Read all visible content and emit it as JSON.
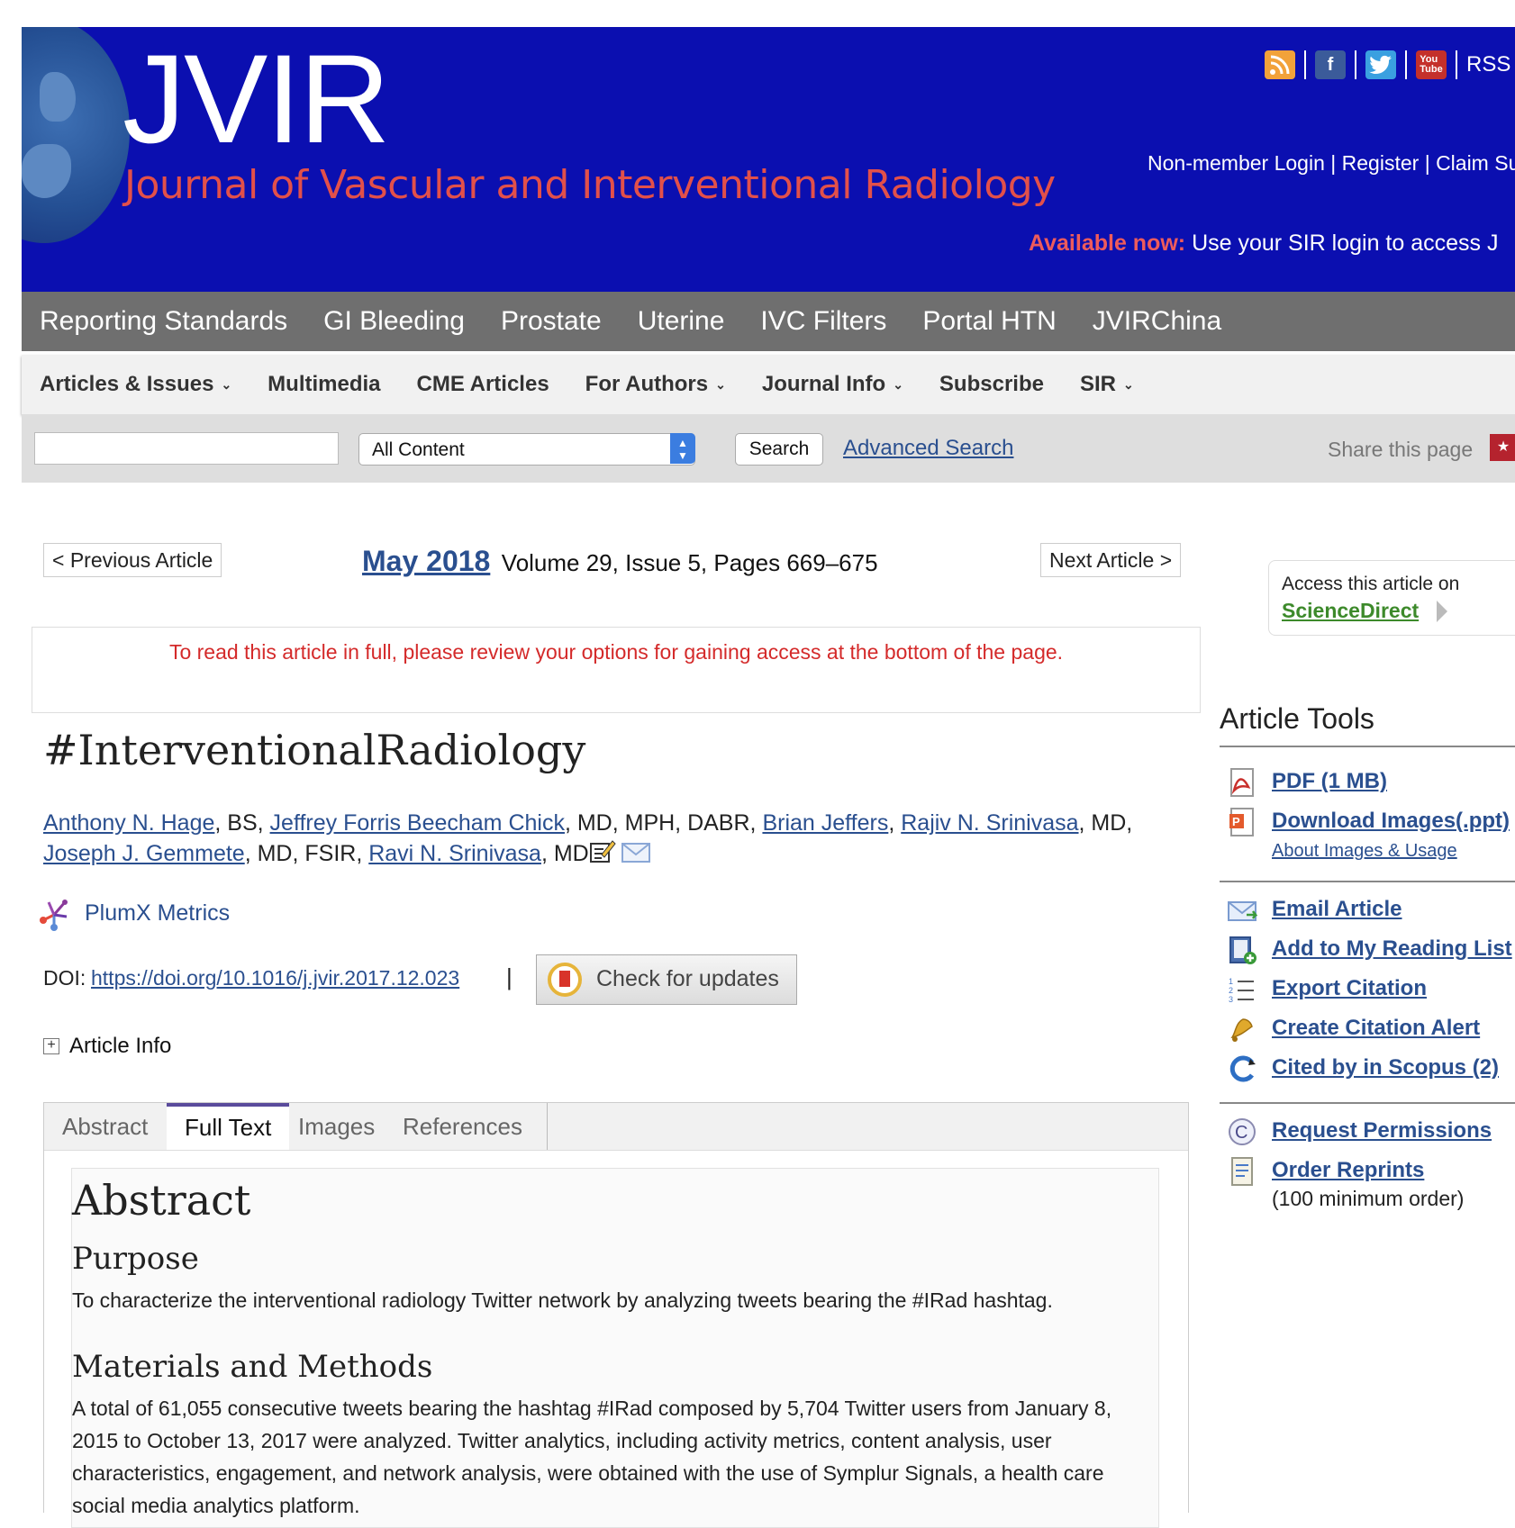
{
  "header": {
    "logo_title": "JVIR",
    "logo_subtitle": "Journal of Vascular and Interventional Radiology",
    "social_icons": [
      "rss-reader-icon",
      "facebook-icon",
      "twitter-icon",
      "youtube-icon"
    ],
    "rss_label": "RSS",
    "login_link": "Non-member Login",
    "register_link": "Register",
    "claim_link": "Claim Sub",
    "sep": "|",
    "promo_label": "Available now:",
    "promo_text": "Use your SIR login to access J",
    "colors": {
      "background": "#0b0fb0",
      "subtitle": "#e2504a",
      "promo": "#ee5b5b"
    }
  },
  "nav_primary": [
    "Reporting Standards",
    "GI Bleeding",
    "Prostate",
    "Uterine",
    "IVC Filters",
    "Portal HTN",
    "JVIRChina"
  ],
  "nav_secondary": [
    {
      "label": "Articles & Issues",
      "dropdown": true
    },
    {
      "label": "Multimedia",
      "dropdown": false
    },
    {
      "label": "CME Articles",
      "dropdown": false
    },
    {
      "label": "For Authors",
      "dropdown": true
    },
    {
      "label": "Journal Info",
      "dropdown": true
    },
    {
      "label": "Subscribe",
      "dropdown": false
    },
    {
      "label": "SIR",
      "dropdown": true
    }
  ],
  "search": {
    "query": "",
    "scope_selected": "All Content",
    "button_label": "Search",
    "advanced_label": "Advanced Search",
    "share_label": "Share this page"
  },
  "article_nav": {
    "prev_label": "< Previous Article",
    "next_label": "Next Article >",
    "issue_date": "May 2018",
    "issue_detail": "Volume 29, Issue 5, Pages 669–675"
  },
  "access_notice": "To read this article in full, please review your options for gaining access at the bottom of the page.",
  "article": {
    "title": "#InterventionalRadiology",
    "authors_line1": [
      {
        "name": "Anthony N. Hage",
        "suffix": ", BS, "
      },
      {
        "name": "Jeffrey Forris Beecham Chick",
        "suffix": ", MD, MPH, DABR, "
      },
      {
        "name": "Brian Jeffers",
        "suffix": ", "
      },
      {
        "name": "Rajiv N. Srinivasa",
        "suffix": ", MD,"
      }
    ],
    "authors_line2": [
      {
        "name": "Joseph J. Gemmete",
        "suffix": ", MD, FSIR, "
      },
      {
        "name": "Ravi N. Srinivasa",
        "suffix": ", MD"
      }
    ],
    "plumx_label": "PlumX Metrics",
    "doi_label": "DOI:",
    "doi_link": "https://doi.org/10.1016/j.jvir.2017.12.023",
    "doi_sep": "|",
    "check_updates_label": "Check for updates",
    "info_toggle": "+",
    "info_label": "Article Info"
  },
  "tabs": [
    {
      "label": "Abstract",
      "active": false
    },
    {
      "label": "Full Text",
      "active": true
    },
    {
      "label": "Images",
      "active": false
    },
    {
      "label": "References",
      "active": false
    }
  ],
  "abstract": {
    "heading": "Abstract",
    "purpose_heading": "Purpose",
    "purpose_text": "To characterize the interventional radiology Twitter network by analyzing tweets bearing the #IRad hashtag.",
    "methods_heading": "Materials and Methods",
    "methods_text": "A total of 61,055 consecutive tweets bearing the hashtag #IRad composed by 5,704 Twitter users from January 8, 2015 to October 13, 2017 were analyzed. Twitter analytics, including activity metrics, content analysis, user characteristics, engagement, and network analysis, were obtained with the use of Symplur Signals, a health care social media analytics platform."
  },
  "sidebar": {
    "sd_label": "Access this article on",
    "sd_link": "ScienceDirect",
    "tools_title": "Article Tools",
    "tools": [
      {
        "label": "PDF (1 MB)",
        "icon": "pdf-icon"
      },
      {
        "label": "Download Images(.ppt)",
        "icon": "powerpoint-icon",
        "sub": "About Images & Usage"
      },
      {
        "label": "Email Article",
        "icon": "email-icon"
      },
      {
        "label": "Add to My Reading List",
        "icon": "reading-list-icon"
      },
      {
        "label": "Export Citation",
        "icon": "export-list-icon"
      },
      {
        "label": "Create Citation Alert",
        "icon": "bell-icon"
      },
      {
        "label": "Cited by in Scopus (2)",
        "icon": "scopus-icon"
      },
      {
        "label": "Request Permissions",
        "icon": "copyright-icon"
      },
      {
        "label": "Order Reprints",
        "icon": "reprints-icon",
        "note": "(100 minimum order)"
      }
    ]
  }
}
